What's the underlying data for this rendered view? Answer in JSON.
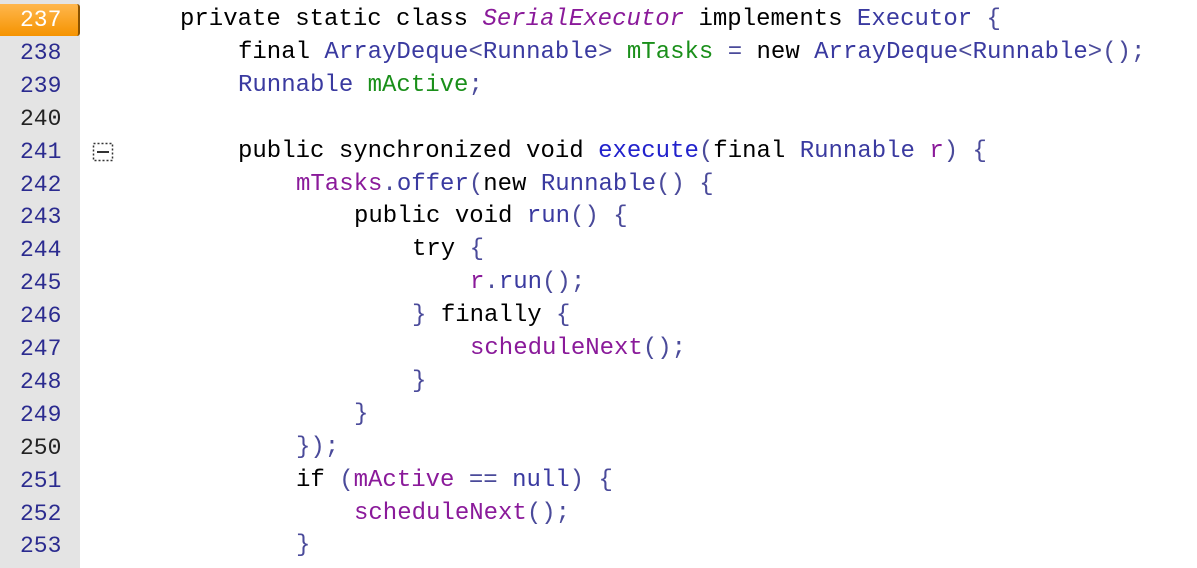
{
  "gutter": {
    "current_line": 0,
    "lines": [
      {
        "number": "237",
        "style": "current"
      },
      {
        "number": "238",
        "style": "normal"
      },
      {
        "number": "239",
        "style": "normal"
      },
      {
        "number": "240",
        "style": "dark"
      },
      {
        "number": "241",
        "style": "normal"
      },
      {
        "number": "242",
        "style": "normal"
      },
      {
        "number": "243",
        "style": "normal"
      },
      {
        "number": "244",
        "style": "normal"
      },
      {
        "number": "245",
        "style": "normal"
      },
      {
        "number": "246",
        "style": "normal"
      },
      {
        "number": "247",
        "style": "normal"
      },
      {
        "number": "248",
        "style": "normal"
      },
      {
        "number": "249",
        "style": "normal"
      },
      {
        "number": "250",
        "style": "dark"
      },
      {
        "number": "251",
        "style": "normal"
      },
      {
        "number": "252",
        "style": "normal"
      },
      {
        "number": "253",
        "style": "normal"
      }
    ]
  },
  "fold_marker": {
    "icon": "fold-collapse-icon",
    "line_index": 4
  },
  "colors": {
    "gutter_bg": "#e4e4e4",
    "current_line_bg": "#f59300",
    "line_number": "#2b2b8f",
    "keyword": "#000000",
    "type": "#3a3aa0",
    "class_name_italic": "#8a1a9a",
    "field": "#1a8f1a",
    "method": "#2222cc",
    "variable": "#8a1a9a",
    "punctuation": "#4a4a9a"
  },
  "code": [
    {
      "indent": 0,
      "tokens": [
        [
          "kw",
          "private static class "
        ],
        [
          "ital",
          "SerialExecutor"
        ],
        [
          "kw",
          " implements "
        ],
        [
          "type",
          "Executor"
        ],
        [
          "punct",
          " {"
        ]
      ]
    },
    {
      "indent": 1,
      "tokens": [
        [
          "kw",
          "final "
        ],
        [
          "type",
          "ArrayDeque"
        ],
        [
          "punct",
          "<"
        ],
        [
          "type",
          "Runnable"
        ],
        [
          "punct",
          "> "
        ],
        [
          "field",
          "mTasks"
        ],
        [
          "punct",
          " = "
        ],
        [
          "kw",
          "new "
        ],
        [
          "type",
          "ArrayDeque"
        ],
        [
          "punct",
          "<"
        ],
        [
          "type",
          "Runnable"
        ],
        [
          "punct",
          ">();"
        ]
      ]
    },
    {
      "indent": 1,
      "tokens": [
        [
          "type",
          "Runnable "
        ],
        [
          "field",
          "mActive"
        ],
        [
          "punct",
          ";"
        ]
      ]
    },
    {
      "indent": 0,
      "tokens": []
    },
    {
      "indent": 1,
      "tokens": [
        [
          "kw",
          "public synchronized void "
        ],
        [
          "method",
          "execute"
        ],
        [
          "punct",
          "("
        ],
        [
          "kw",
          "final "
        ],
        [
          "type",
          "Runnable "
        ],
        [
          "var",
          "r"
        ],
        [
          "punct",
          ") {"
        ]
      ]
    },
    {
      "indent": 2,
      "tokens": [
        [
          "var",
          "mTasks"
        ],
        [
          "punct",
          "."
        ],
        [
          "type",
          "offer"
        ],
        [
          "punct",
          "("
        ],
        [
          "kw",
          "new "
        ],
        [
          "type",
          "Runnable"
        ],
        [
          "punct",
          "() {"
        ]
      ]
    },
    {
      "indent": 3,
      "tokens": [
        [
          "kw",
          "public void "
        ],
        [
          "type",
          "run"
        ],
        [
          "punct",
          "() {"
        ]
      ]
    },
    {
      "indent": 4,
      "tokens": [
        [
          "kw",
          "try "
        ],
        [
          "punct",
          "{"
        ]
      ]
    },
    {
      "indent": 5,
      "tokens": [
        [
          "var",
          "r"
        ],
        [
          "punct",
          "."
        ],
        [
          "type",
          "run"
        ],
        [
          "punct",
          "();"
        ]
      ]
    },
    {
      "indent": 4,
      "tokens": [
        [
          "punct",
          "} "
        ],
        [
          "kw",
          "finally "
        ],
        [
          "punct",
          "{"
        ]
      ]
    },
    {
      "indent": 5,
      "tokens": [
        [
          "var",
          "scheduleNext"
        ],
        [
          "punct",
          "();"
        ]
      ]
    },
    {
      "indent": 4,
      "tokens": [
        [
          "punct",
          "}"
        ]
      ]
    },
    {
      "indent": 3,
      "tokens": [
        [
          "punct",
          "}"
        ]
      ]
    },
    {
      "indent": 2,
      "tokens": [
        [
          "punct",
          "});"
        ]
      ]
    },
    {
      "indent": 2,
      "tokens": [
        [
          "kw",
          "if "
        ],
        [
          "punct",
          "("
        ],
        [
          "var",
          "mActive"
        ],
        [
          "punct",
          " == "
        ],
        [
          "type",
          "null"
        ],
        [
          "punct",
          ") {"
        ]
      ]
    },
    {
      "indent": 3,
      "tokens": [
        [
          "var",
          "scheduleNext"
        ],
        [
          "punct",
          "();"
        ]
      ]
    },
    {
      "indent": 2,
      "tokens": [
        [
          "punct",
          "}"
        ]
      ]
    }
  ]
}
